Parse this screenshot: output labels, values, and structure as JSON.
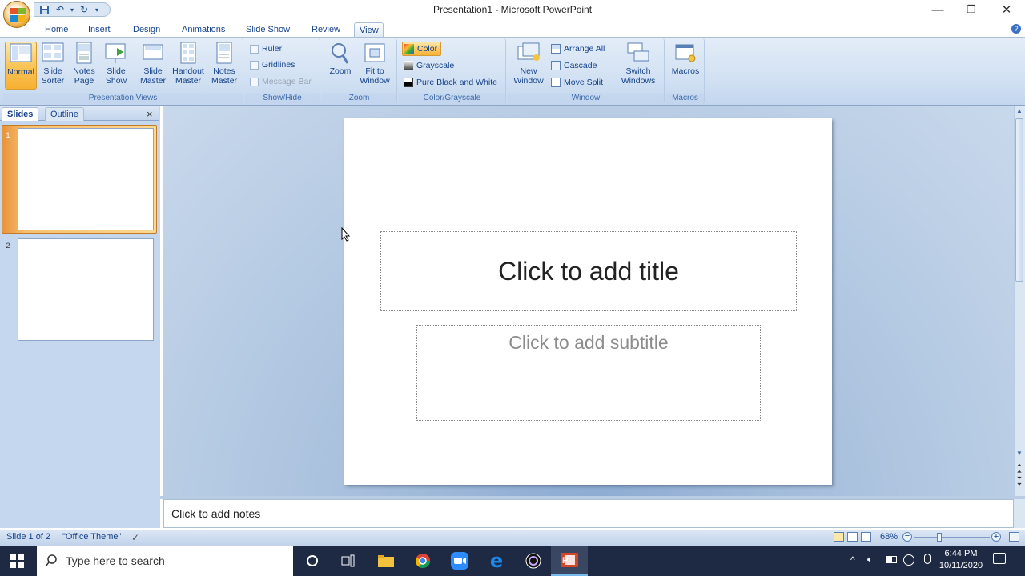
{
  "window": {
    "title": "Presentation1 - Microsoft PowerPoint",
    "minimize": "—",
    "restore": "❐",
    "close": "✕"
  },
  "tabs": [
    "Home",
    "Insert",
    "Design",
    "Animations",
    "Slide Show",
    "Review",
    "View"
  ],
  "active_tab": "View",
  "ribbon": {
    "presentation_views": {
      "label": "Presentation Views",
      "buttons": [
        "Normal",
        "Slide Sorter",
        "Notes Page",
        "Slide Show",
        "Slide Master",
        "Handout Master",
        "Notes Master"
      ]
    },
    "show_hide": {
      "label": "Show/Hide",
      "items": [
        "Ruler",
        "Gridlines",
        "Message Bar"
      ]
    },
    "zoom": {
      "label": "Zoom",
      "buttons": [
        "Zoom",
        "Fit to Window"
      ]
    },
    "color_grayscale": {
      "label": "Color/Grayscale",
      "items": [
        "Color",
        "Grayscale",
        "Pure Black and White"
      ]
    },
    "window": {
      "label": "Window",
      "new_window": "New Window",
      "items": [
        "Arrange All",
        "Cascade",
        "Move Split"
      ],
      "switch": "Switch Windows"
    },
    "macros": {
      "label": "Macros",
      "button": "Macros"
    }
  },
  "slides_pane": {
    "tabs": [
      "Slides",
      "Outline"
    ],
    "close": "×",
    "slides": [
      "1",
      "2"
    ]
  },
  "slide": {
    "title_placeholder": "Click to add title",
    "subtitle_placeholder": "Click to add subtitle"
  },
  "notes_placeholder": "Click to add notes",
  "status": {
    "slide_info": "Slide 1 of 2",
    "theme": "\"Office Theme\"",
    "zoom": "68%"
  },
  "taskbar": {
    "search_placeholder": "Type here to search",
    "time": "6:44 PM",
    "date": "10/11/2020"
  },
  "colors": {
    "ribbon_bg": "#cfdff2",
    "accent_orange": "#f7b133",
    "taskbar": "#1e2a44"
  }
}
